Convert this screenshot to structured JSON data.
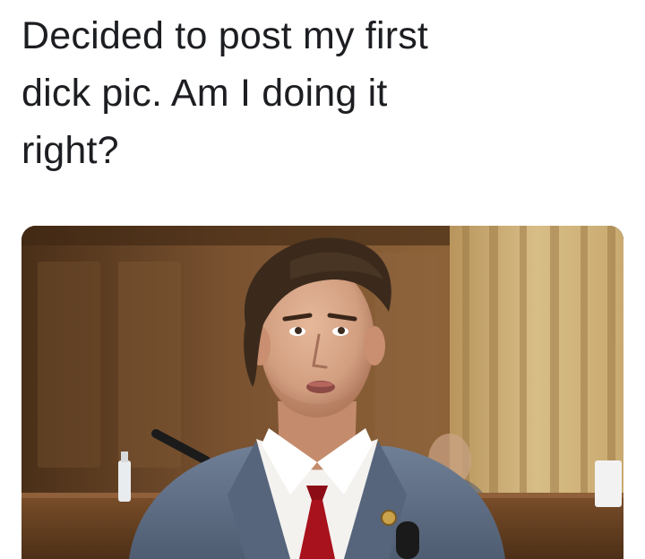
{
  "post": {
    "text_lines": [
      "Decided to post my first",
      "dick pic.  Am I doing it",
      "right?"
    ]
  },
  "photo": {
    "subject": "man in grey suit with red tie at a wood-paneled hearing room",
    "colors": {
      "wood_dark": "#5a3a1e",
      "wood_mid": "#8a5d33",
      "wood_light": "#b58a55",
      "suit": "#5f6f86",
      "tie": "#a8121c",
      "shirt": "#f3f1ee",
      "hair": "#3a2a1c",
      "skin": "#d9a98a"
    }
  }
}
